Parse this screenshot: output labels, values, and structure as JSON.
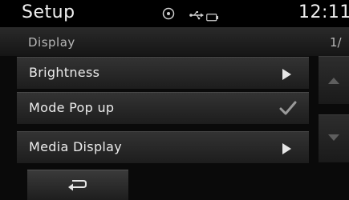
{
  "header": {
    "title": "Setup",
    "clock": "12:11",
    "icons": [
      "disc-icon",
      "usb-icon",
      "battery-icon"
    ]
  },
  "subheader": {
    "title": "Display",
    "page_indicator": "1/"
  },
  "menu": {
    "items": [
      {
        "label": "Brightness",
        "control": "arrow-right-icon"
      },
      {
        "label": "Mode Pop up",
        "control": "checkmark-icon",
        "checked": true
      },
      {
        "label": "Media Display",
        "control": "arrow-right-icon"
      }
    ]
  },
  "scroll": {
    "up_icon": "scroll-up-icon",
    "down_icon": "scroll-down-icon"
  },
  "footer": {
    "back_icon": "back-arrow-icon"
  },
  "colors": {
    "background": "#0a0a0a",
    "item_top": "#333333",
    "item_bottom": "#1d1d1d",
    "text": "#ececec",
    "disabled_arrow": "#5e5e5e"
  }
}
